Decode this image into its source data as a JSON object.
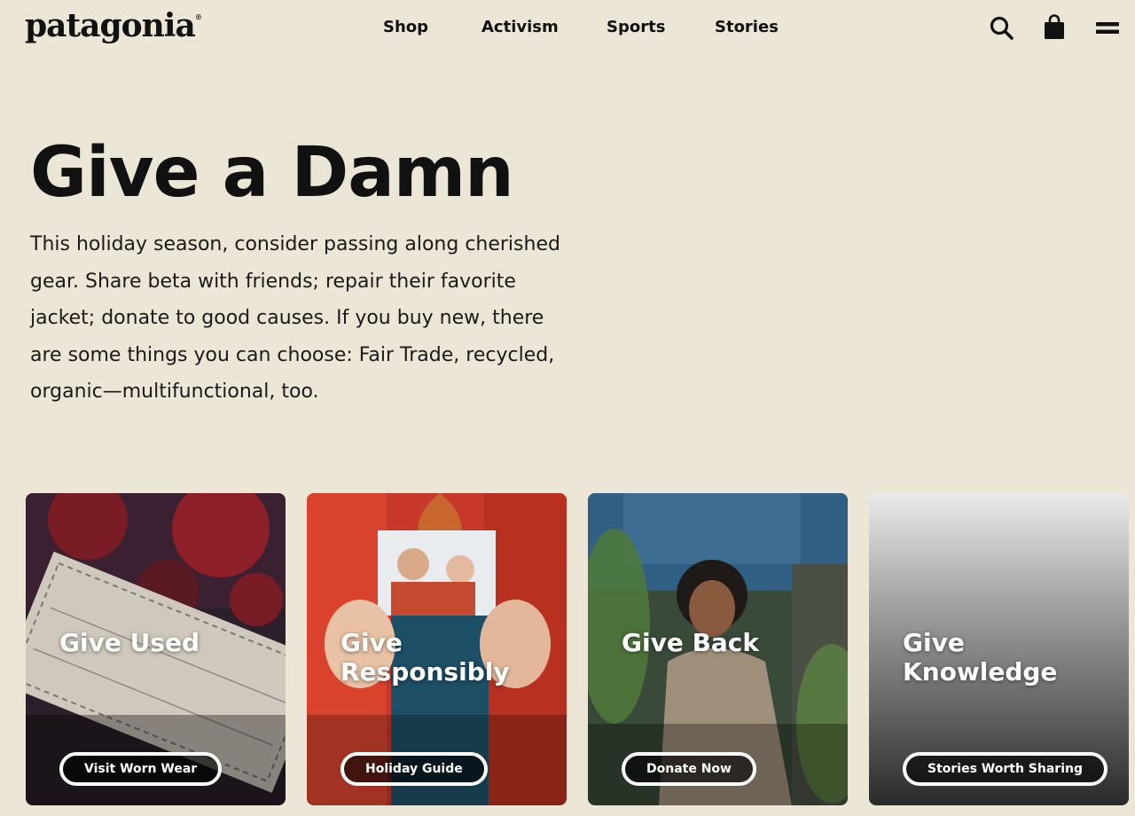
{
  "header": {
    "logo": "patagonia",
    "logo_mark": "®",
    "nav": [
      "Shop",
      "Activism",
      "Sports",
      "Stories"
    ],
    "icons": [
      "search-icon",
      "shopping-bag-icon",
      "menu-icon"
    ]
  },
  "hero": {
    "title": "Give a Damn",
    "body_lines": [
      "This holiday season, consider passing along cherished",
      "gear. Share beta with friends; repair their favorite",
      "jacket; donate to good causes. If you buy new, there",
      "are some things you can choose: Fair Trade, recycled,",
      "organic—multifunctional, too."
    ]
  },
  "cards": [
    {
      "title": "Give Used",
      "button": "Visit Worn Wear"
    },
    {
      "title": "Give Responsibly",
      "button": "Holiday Guide"
    },
    {
      "title": "Give Back",
      "button": "Donate Now"
    },
    {
      "title": "Give Knowledge",
      "button": "Stories Worth Sharing"
    }
  ],
  "colors": {
    "background": "#ebe6d6",
    "text": "#111111",
    "button_border": "#ffffff"
  }
}
